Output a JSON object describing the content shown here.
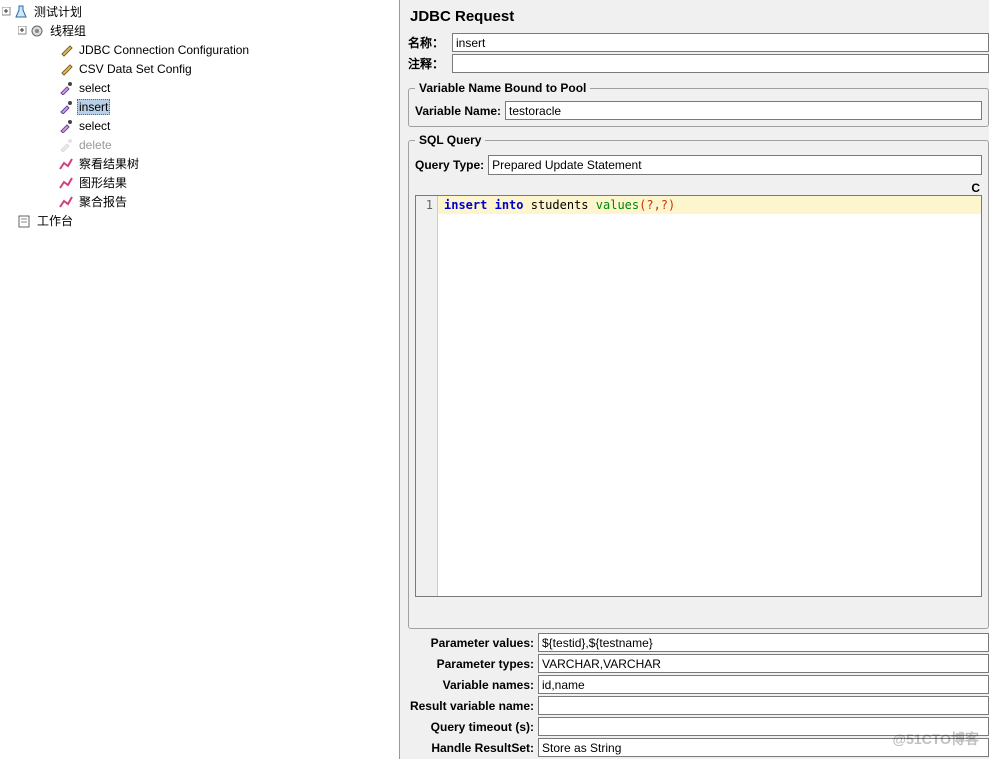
{
  "tree": {
    "root": {
      "label": "测试计划"
    },
    "thread_group": {
      "label": "线程组"
    },
    "children": [
      {
        "label": "JDBC Connection Configuration"
      },
      {
        "label": "CSV Data Set Config"
      },
      {
        "label": "select"
      },
      {
        "label": "insert",
        "selected": true
      },
      {
        "label": "select"
      },
      {
        "label": "delete",
        "disabled": true
      },
      {
        "label": "察看结果树"
      },
      {
        "label": "图形结果"
      },
      {
        "label": "聚合报告"
      }
    ],
    "workbench": {
      "label": "工作台"
    }
  },
  "panel": {
    "title": "JDBC Request",
    "name_label": "名称：",
    "name_value": "insert",
    "comment_label": "注释：",
    "comment_value": "",
    "var_group_title": "Variable Name Bound to Pool",
    "var_name_label": "Variable Name:",
    "var_name_value": "testoracle",
    "sql_group_title": "SQL Query",
    "query_type_label": "Query Type:",
    "query_type_value": "Prepared Update Statement",
    "right_char": "C",
    "code": {
      "line_no": "1",
      "kw1": "insert",
      "kw2": "into",
      "tbl": "students",
      "fn": "values",
      "args": "(?,?)"
    },
    "param_values_label": "Parameter values:",
    "param_values_value": "${testid},${testname}",
    "param_types_label": "Parameter types:",
    "param_types_value": "VARCHAR,VARCHAR",
    "var_names_label": "Variable names:",
    "var_names_value": "id,name",
    "result_var_label": "Result variable name:",
    "result_var_value": "",
    "timeout_label": "Query timeout (s):",
    "timeout_value": "",
    "handle_rs_label": "Handle ResultSet:",
    "handle_rs_value": "Store as String"
  },
  "watermark": "@51CTO博客"
}
